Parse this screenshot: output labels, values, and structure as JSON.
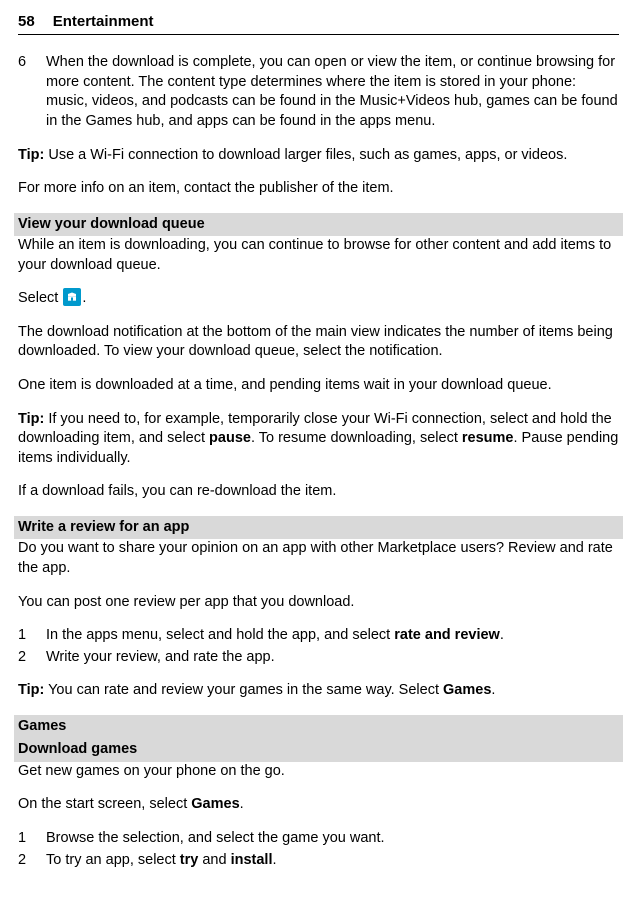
{
  "header": {
    "page_number": "58",
    "chapter": "Entertainment"
  },
  "intro_step": {
    "num": "6",
    "text": "When the download is complete, you can open or view the item, or continue browsing for more content. The content type determines where the item is stored in your phone: music, videos, and podcasts can be found in the Music+Videos hub, games can be found in the Games hub, and apps can be found in the apps menu."
  },
  "tip1_label": "Tip:",
  "tip1_text": " Use a Wi-Fi connection to download larger files, such as games, apps, or videos.",
  "moreinfo": "For more info on an item, contact the publisher of the item.",
  "section_viewqueue": {
    "heading": "View your download queue",
    "p1": "While an item is downloading, you can continue to browse for other content and add items to your download queue.",
    "select_pre": "Select ",
    "select_post": ".",
    "p2": "The download notification at the bottom of the main view indicates the number of items being downloaded. To view your download queue, select the notification.",
    "p3": "One item is downloaded at a time, and pending items wait in your download queue.",
    "tip_label": "Tip:",
    "tip_pre": " If you need to, for example, temporarily close your Wi-Fi connection, select and hold the downloading item, and select ",
    "tip_pause": "pause",
    "tip_mid": ". To resume downloading, select ",
    "tip_resume": "resume",
    "tip_post": ". Pause pending items individually.",
    "p4": "If a download fails, you can re-download the item."
  },
  "section_review": {
    "heading": "Write a review for an app",
    "p1": "Do you want to share your opinion on an app with other Marketplace users? Review and rate the app.",
    "p2": "You can post one review per app that you download.",
    "step1_num": "1",
    "step1_pre": "In the apps menu, select and hold the app, and select ",
    "step1_bold": "rate and review",
    "step1_post": ".",
    "step2_num": "2",
    "step2_text": "Write your review, and rate the app.",
    "tip_label": "Tip:",
    "tip_pre": " You can rate and review your games in the same way. Select ",
    "tip_bold": "Games",
    "tip_post": "."
  },
  "section_games": {
    "heading1": "Games",
    "heading2": "Download games",
    "p1": "Get new games on your phone on the go.",
    "p2_pre": "On the start screen, select ",
    "p2_bold": "Games",
    "p2_post": ".",
    "step1_num": "1",
    "step1_text": "Browse the selection, and select the game you want.",
    "step2_num": "2",
    "step2_pre": "To try an app, select ",
    "step2_try": "try",
    "step2_mid": " and ",
    "step2_install": "install",
    "step2_post": "."
  }
}
